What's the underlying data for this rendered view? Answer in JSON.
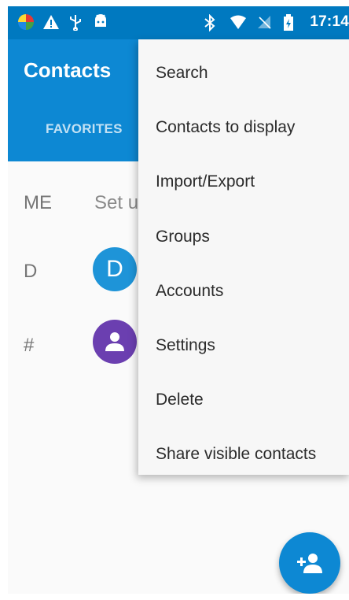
{
  "status_bar": {
    "time": "17:14",
    "left_icons": [
      "app-icon",
      "warning-icon",
      "usb-icon",
      "android-icon"
    ],
    "right_icons": [
      "bluetooth-icon",
      "wifi-icon",
      "no-signal-icon",
      "battery-charging-icon"
    ]
  },
  "app_bar": {
    "title": "Contacts",
    "tab_favorites": "FAVORITES"
  },
  "contacts": {
    "me_label": "ME",
    "me_text": "Set u",
    "section_d": "D",
    "avatar_d_letter": "D",
    "section_hash": "#"
  },
  "menu": {
    "items": [
      "Search",
      "Contacts to display",
      "Import/Export",
      "Groups",
      "Accounts",
      "Settings",
      "Delete",
      "Share visible contacts"
    ]
  },
  "colors": {
    "status_bar": "#0079c0",
    "app_bar": "#0d88d3",
    "avatar_d": "#1e94d8",
    "avatar_hash": "#6b3fb0",
    "fab": "#0d88d3"
  },
  "fab": {
    "icon": "add-contact-icon"
  }
}
